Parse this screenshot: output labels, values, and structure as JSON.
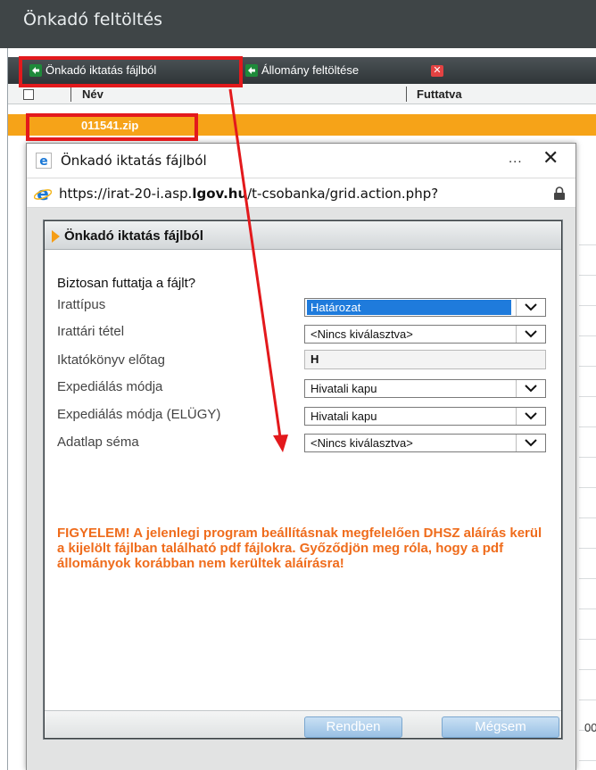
{
  "page": {
    "title": "Önkadó feltöltés"
  },
  "toolbar": {
    "import_label": "Önkadó iktatás fájlból",
    "upload_label": "Állomány feltöltése"
  },
  "grid": {
    "col_name": "Név",
    "col_run": "Futtatva",
    "selected_file": "011541.zip",
    "right_fragment": "00"
  },
  "window": {
    "title": "Önkadó iktatás fájlból",
    "dots": "...",
    "close": "✕",
    "url_prefix": "https://irat-20-i.asp.",
    "url_domain": "lgov.hu",
    "url_suffix": "/t-csobanka/grid.action.php?"
  },
  "dialog": {
    "title": "Önkadó iktatás fájlból",
    "question": "Biztosan futtatja a fájlt?",
    "fields": {
      "irattipus": {
        "label": "Irattípus",
        "value": "Határozat"
      },
      "irattari_tetel": {
        "label": "Irattári tétel",
        "value": "<Nincs kiválasztva>"
      },
      "iktatokonyv": {
        "label": "Iktatókönyv előtag",
        "value": "H"
      },
      "expedialas": {
        "label": "Expediálás módja",
        "value": "Hivatali kapu"
      },
      "expedialas_elugy": {
        "label": "Expediálás módja (ELÜGY)",
        "value": "Hivatali kapu"
      },
      "adatlap": {
        "label": "Adatlap séma",
        "value": "<Nincs kiválasztva>"
      }
    },
    "warning": "FIGYELEM! A jelenlegi program beállításnak megfelelően DHSZ aláírás kerül a kijelölt fájlban található pdf fájlokra. Győződjön meg róla, hogy a pdf állományok korábban nem kerültek aláírásra!",
    "ok_label": "Rendben",
    "cancel_label": "Mégsem"
  },
  "colors": {
    "accent_orange": "#f6a318",
    "warning_text": "#ef6c1c",
    "annotation_red": "#e3191c",
    "selection_blue": "#1f7bdc"
  },
  "icons": [
    "import-icon",
    "upload-icon",
    "delete-icon",
    "ie-icon",
    "lock-icon",
    "chevron-down-icon",
    "arrow-right-icon"
  ]
}
